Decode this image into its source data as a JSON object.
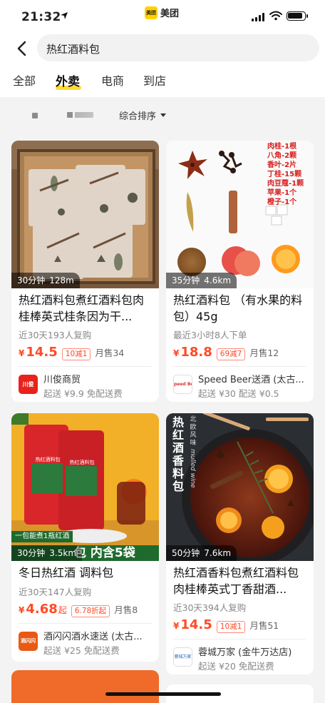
{
  "status_bar": {
    "time": "21:32",
    "app_name": "美团",
    "app_logo_text": "美团"
  },
  "search": {
    "query": "热红酒料包"
  },
  "tabs": [
    {
      "label": "全部",
      "active": false
    },
    {
      "label": "外卖",
      "active": true
    },
    {
      "label": "电商",
      "active": false
    },
    {
      "label": "到店",
      "active": false
    }
  ],
  "filters": {
    "sort_label": "综合排序"
  },
  "accent_colors": {
    "brand_yellow": "#ffd100",
    "price_red": "#ff4a26"
  },
  "products": [
    {
      "delivery_time": "30分钟",
      "distance": "128m",
      "title": "热红酒料包煮红酒料包肉桂棒英式桂条因为干...",
      "stat": "近30天193人复购",
      "currency": "¥",
      "price": "14.5",
      "price_suffix": "",
      "promo": "10减1",
      "sold": "月售34",
      "shop_name": "川俊商贸",
      "shop_logo_text": "川俊",
      "shop_meta": "起送 ¥9.9  免配送费"
    },
    {
      "delivery_time": "35分钟",
      "distance": "4.6km",
      "title": "热红酒料包 （有水果的料包）45g",
      "stat": "最近3小时8人下单",
      "currency": "¥",
      "price": "18.8",
      "price_suffix": "",
      "promo": "69减7",
      "sold": "月售12",
      "shop_name": "Speed Beer送酒 (太古...",
      "shop_logo_text": "peed Bee",
      "shop_meta": "起送 ¥30  配送 ¥0.5",
      "image_labels": [
        "肉桂-1根",
        "八角-2颗",
        "香叶-2片",
        "丁桂-15颗",
        "肉豆蔻-1颗",
        "苹果-1个",
        "橙子-1个"
      ]
    },
    {
      "delivery_time": "30分钟",
      "distance": "3.5km",
      "title": "冬日热红酒 调料包",
      "stat": "近30天147人复购",
      "currency": "¥",
      "price": "4.68",
      "price_suffix": "起",
      "promo": "6.78折起",
      "sold": "月售8",
      "shop_name": "酒闪闪酒水速送 (太古...",
      "shop_logo_text": "酒闪闪",
      "shop_meta": "起送 ¥25  免配送费",
      "image_banner": "一包能煮1瓶红酒",
      "image_caption": "包 内含5袋",
      "image_bag_label": "热红酒料包"
    },
    {
      "delivery_time": "50分钟",
      "distance": "7.6km",
      "title": "热红酒香料包煮红酒料包肉桂棒英式丁香甜酒...",
      "stat": "近30天394人复购",
      "currency": "¥",
      "price": "14.5",
      "price_suffix": "",
      "promo": "10减1",
      "sold": "月售51",
      "shop_name": "蓉城万家 (金牛万达店)",
      "shop_logo_text": "蓉城万家",
      "shop_meta": "起送 ¥20  免配送费",
      "image_vertical_title": [
        "热",
        "红",
        "酒",
        "香",
        "料",
        "包"
      ],
      "image_sub_vertical": [
        "北",
        "欧",
        "风",
        "味"
      ],
      "image_english": "mulled wine"
    }
  ]
}
